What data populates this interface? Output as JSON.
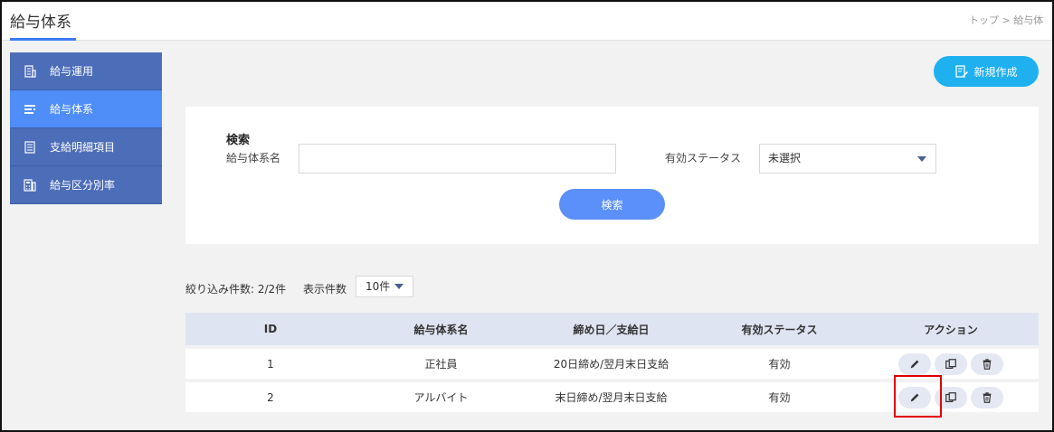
{
  "header": {
    "title": "給与体系",
    "breadcrumb": "トップ > 給与体"
  },
  "sidebar": {
    "items": [
      {
        "label": "給与運用",
        "icon": "building-icon"
      },
      {
        "label": "給与体系",
        "icon": "hierarchy-icon"
      },
      {
        "label": "支給明細項目",
        "icon": "list-document-icon"
      },
      {
        "label": "給与区分別率",
        "icon": "calculator-icon"
      }
    ],
    "active_index": 1
  },
  "toolbar": {
    "new_label": "新規作成"
  },
  "search": {
    "heading": "検索",
    "name_label": "給与体系名",
    "name_value": "",
    "status_label": "有効ステータス",
    "status_value": "未選択",
    "button_label": "検索"
  },
  "listing": {
    "filter_count": "絞り込み件数: 2/2件",
    "per_page_label": "表示件数",
    "per_page_value": "10件"
  },
  "table": {
    "headers": [
      "ID",
      "給与体系名",
      "締め日／支給日",
      "有効ステータス",
      "アクション"
    ],
    "rows": [
      [
        "1",
        "正社員",
        "20日締め/翌月末日支給",
        "有効"
      ],
      [
        "2",
        "アルバイト",
        "末日締め/翌月末日支給",
        "有効"
      ]
    ]
  },
  "colors": {
    "sidebar_bg": "#4c6db8",
    "sidebar_active": "#4f8df9",
    "new_button": "#1fb0f0",
    "search_button": "#5b8ff9",
    "table_header": "#dfe4f2",
    "highlight": "#e00000"
  }
}
